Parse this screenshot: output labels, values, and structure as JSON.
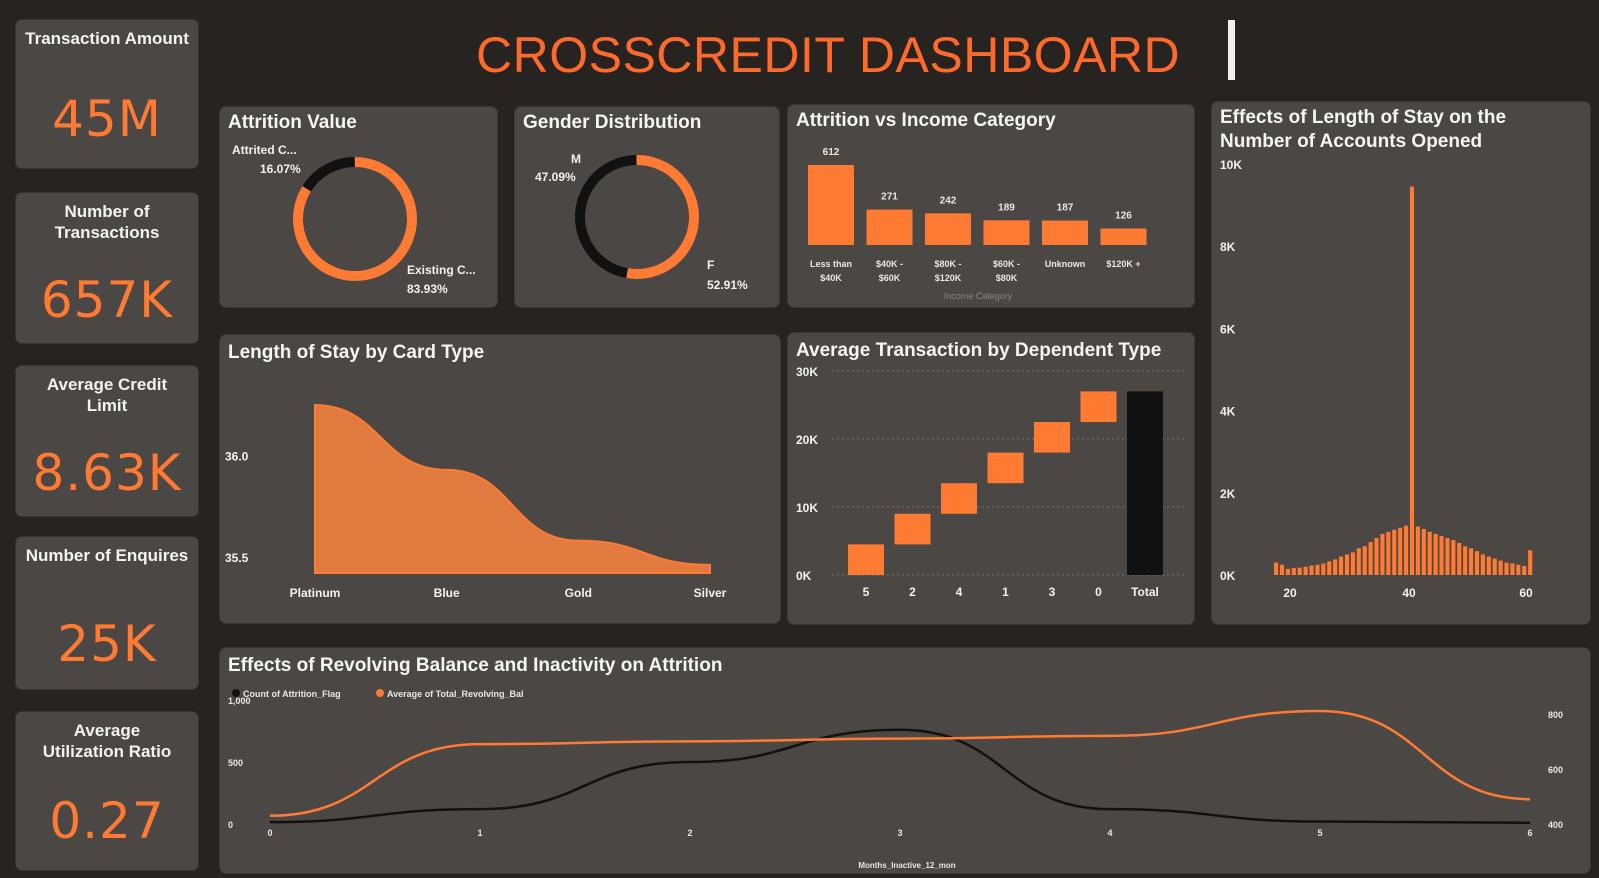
{
  "dashboard": {
    "title": "CROSSCREDIT DASHBOARD"
  },
  "kpis": [
    {
      "label": "Transaction Amount",
      "value": "45M"
    },
    {
      "label": "Number of Transactions",
      "value": "657K"
    },
    {
      "label": "Average Credit Limit",
      "value": "8.63K"
    },
    {
      "label": "Number of Enquires",
      "value": "25K"
    },
    {
      "label": "Average Utilization Ratio",
      "value": "0.27"
    }
  ],
  "colors": {
    "accent": "#ff7a33",
    "title": "#ff6a2a",
    "panel": "#4b4744",
    "background": "#262320",
    "dark": "#111111"
  },
  "chart_data": [
    {
      "id": "attrition",
      "type": "pie",
      "title": "Attrition Value",
      "labels": [
        "Attrited C...",
        "Existing C..."
      ],
      "values": [
        16.07,
        83.93
      ],
      "value_labels": [
        "16.07%",
        "83.93%"
      ]
    },
    {
      "id": "gender",
      "type": "pie",
      "title": "Gender Distribution",
      "labels": [
        "M",
        "F"
      ],
      "values": [
        47.09,
        52.91
      ],
      "value_labels": [
        "47.09%",
        "52.91%"
      ]
    },
    {
      "id": "income",
      "type": "bar",
      "title": "Attrition vs Income Category",
      "xlabel": "Income Category",
      "categories": [
        "Less than $40K",
        "$40K - $60K",
        "$80K - $120K",
        "$60K - $80K",
        "Unknown",
        "$120K +"
      ],
      "values": [
        612,
        271,
        242,
        189,
        187,
        126
      ]
    },
    {
      "id": "length_stay",
      "type": "histogram",
      "title": "Effects of Length of Stay on the Number of Accounts Opened",
      "x_ticks": [
        "20",
        "40",
        "60"
      ],
      "y_ticks": [
        "0K",
        "2K",
        "4K",
        "6K",
        "8K",
        "10K"
      ],
      "xlim": [
        13,
        60
      ],
      "ylim": [
        0,
        10000
      ],
      "x": [
        13,
        14,
        15,
        16,
        17,
        18,
        19,
        20,
        21,
        22,
        23,
        24,
        25,
        26,
        27,
        28,
        29,
        30,
        31,
        32,
        33,
        34,
        35,
        36,
        37,
        38,
        39,
        40,
        41,
        42,
        43,
        44,
        45,
        46,
        47,
        48,
        49,
        50,
        51,
        52,
        53,
        54,
        55,
        56
      ],
      "values": [
        300,
        250,
        150,
        170,
        180,
        200,
        230,
        250,
        280,
        330,
        380,
        450,
        500,
        550,
        650,
        700,
        800,
        900,
        1000,
        1050,
        1100,
        1150,
        1200,
        9450,
        1180,
        1120,
        1050,
        1000,
        950,
        900,
        850,
        780,
        700,
        650,
        580,
        500,
        450,
        400,
        350,
        300,
        280,
        250,
        220,
        600
      ]
    },
    {
      "id": "card_type",
      "type": "area",
      "title": "Length of Stay by Card Type",
      "categories": [
        "Platinum",
        "Blue",
        "Gold",
        "Silver"
      ],
      "values": [
        36.25,
        35.93,
        35.58,
        35.46
      ],
      "y_ticks": [
        "36.0",
        "35.5"
      ],
      "ylim": [
        35.42,
        36.3
      ]
    },
    {
      "id": "dependents",
      "type": "waterfall",
      "title": "Average Transaction by Dependent Type",
      "categories": [
        "5",
        "2",
        "4",
        "1",
        "3",
        "0",
        "Total"
      ],
      "values": [
        4500,
        4500,
        4500,
        4500,
        4500,
        4500,
        27000
      ],
      "y_ticks": [
        "0K",
        "10K",
        "20K",
        "30K"
      ],
      "ylim": [
        0,
        30000
      ]
    },
    {
      "id": "revolving",
      "type": "line",
      "title": "Effects of Revolving Balance and Inactivity on Attrition",
      "xlabel": "Months_Inactive_12_mon",
      "x": [
        0,
        1,
        2,
        3,
        4,
        5,
        6
      ],
      "series": [
        {
          "name": "Count of Attrition_Flag",
          "color": "#111111",
          "values": [
            15,
            120,
            500,
            760,
            120,
            20,
            10
          ],
          "axis": "left"
        },
        {
          "name": "Average of Total_Revolving_Bal",
          "color": "#ff7a33",
          "values": [
            430,
            690,
            700,
            710,
            720,
            810,
            490
          ],
          "axis": "right"
        }
      ],
      "left_ticks": [
        "1,000",
        "500",
        "0"
      ],
      "right_ticks": [
        "800",
        "600",
        "400"
      ],
      "left_ylim": [
        0,
        1000
      ],
      "right_ylim": [
        400,
        850
      ]
    }
  ]
}
